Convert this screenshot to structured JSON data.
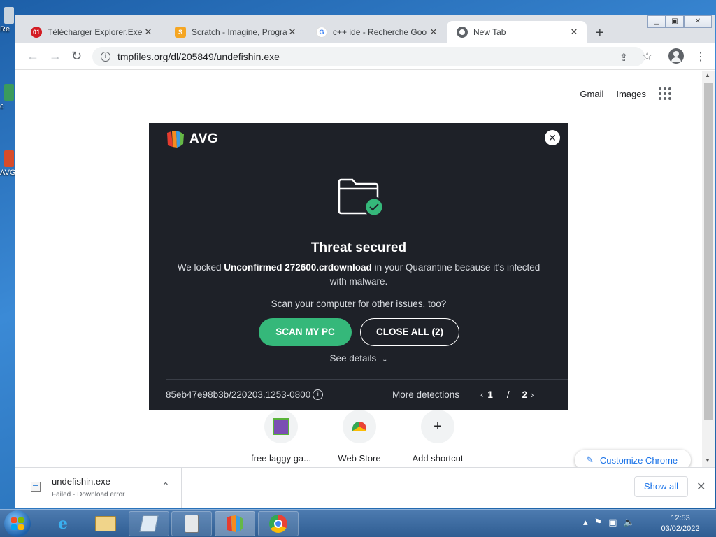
{
  "desktop": {
    "icons": [
      {
        "label": "Re"
      },
      {
        "label": "c"
      },
      {
        "label": "AVG"
      }
    ]
  },
  "browser": {
    "tabs": [
      {
        "title": "Télécharger Explorer.Exe F",
        "favicon": "01",
        "favicon_color": "#d31c23",
        "active": false
      },
      {
        "title": "Scratch - Imagine, Progra",
        "favicon": "S",
        "favicon_color": "#f5a623",
        "active": false
      },
      {
        "title": "c++ ide - Recherche Goo",
        "favicon": "G",
        "favicon_color": "#4285f4",
        "active": false
      },
      {
        "title": "New Tab",
        "favicon": "chrome",
        "favicon_color": "#5f6368",
        "active": true
      }
    ],
    "address": "tmpfiles.org/dl/205849/undefishin.exe",
    "top_links": {
      "gmail": "Gmail",
      "images": "Images"
    }
  },
  "avg_popup": {
    "brand": "AVG",
    "headline": "Threat secured",
    "desc_prefix": "We locked ",
    "file": "Unconfirmed 272600.crdownload",
    "desc_suffix": " in your Quarantine because it's infected with malware.",
    "question": "Scan your computer for other issues, too?",
    "scan_button": "SCAN MY PC",
    "close_all_button": "CLOSE ALL (2)",
    "see_details": "See details",
    "detection_id": "85eb47e98b3b/220203.1253-0800",
    "more_detections": "More detections",
    "page_current": "1",
    "page_separator": "/",
    "page_total": "2",
    "accent_color": "#35b87a"
  },
  "shortcuts": [
    {
      "label": "free laggy ga...",
      "icon": "game-thumbnail-icon"
    },
    {
      "label": "Web Store",
      "icon": "web-store-icon"
    },
    {
      "label": "Add shortcut",
      "icon": "plus-icon"
    }
  ],
  "customize_chrome": "Customize Chrome",
  "download_shelf": {
    "filename": "undefishin.exe",
    "status": "Failed - Download error",
    "show_all": "Show all"
  },
  "taskbar": {
    "time": "12:53",
    "date": "03/02/2022"
  }
}
